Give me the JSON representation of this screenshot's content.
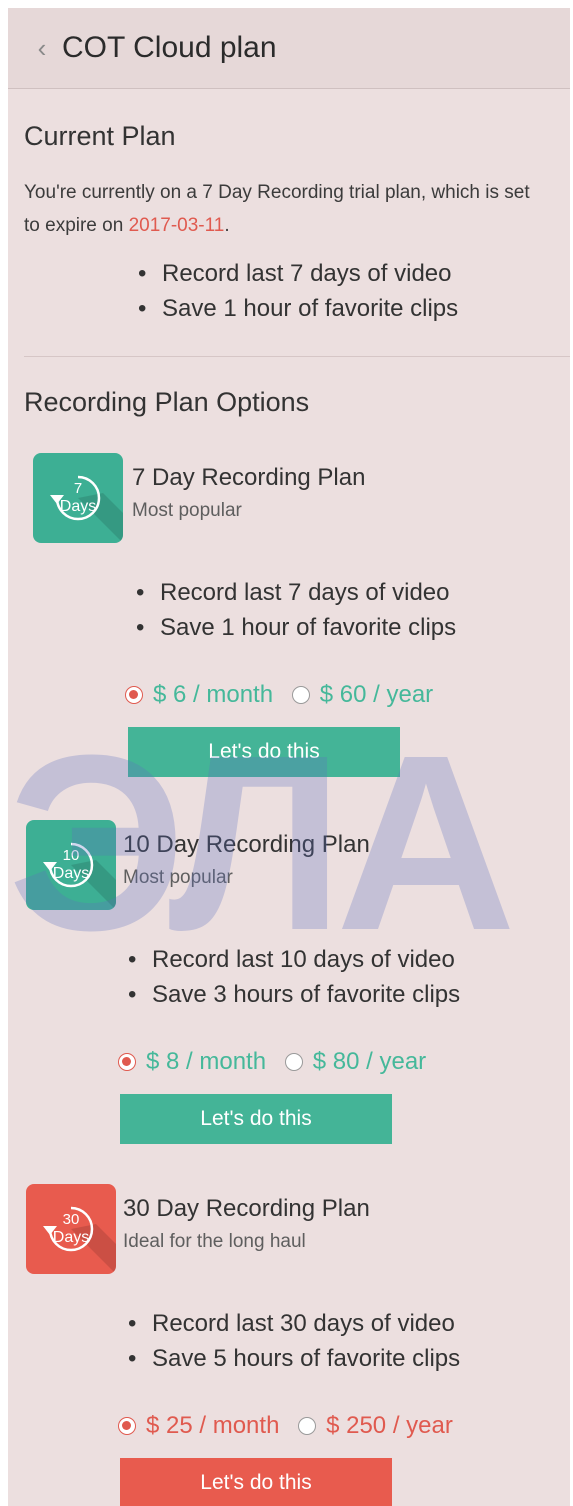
{
  "header": {
    "back_icon": "chevron-left-icon",
    "title": "COT Cloud plan"
  },
  "current_plan": {
    "heading": "Current Plan",
    "text_prefix": "You're currently on a 7 Day Recording trial plan, which is set to expire on ",
    "expiry_date": "2017-03-11",
    "text_suffix": ".",
    "features": [
      "Record last 7 days of video",
      "Save 1 hour of favorite clips"
    ]
  },
  "options_heading": "Recording Plan Options",
  "plans": [
    {
      "icon_number": "7",
      "icon_unit": "Days",
      "icon_color": "#3daf94",
      "name": "7 Day Recording Plan",
      "tagline": "Most popular",
      "features": [
        "Record last 7 days of video",
        "Save 1 hour of favorite clips"
      ],
      "monthly": "$ 6 / month",
      "yearly": "$ 60 / year",
      "selected": "monthly",
      "price_color": "#45b89a",
      "cta": "Let's do this",
      "cta_color": "#44b497"
    },
    {
      "icon_number": "10",
      "icon_unit": "Days",
      "icon_color": "#3daf94",
      "name": "10 Day Recording Plan",
      "tagline": "Most popular",
      "features": [
        "Record last 10 days of video",
        "Save 3 hours of favorite clips"
      ],
      "monthly": "$ 8 / month",
      "yearly": "$ 80 / year",
      "selected": "monthly",
      "price_color": "#45b89a",
      "cta": "Let's do this",
      "cta_color": "#44b497"
    },
    {
      "icon_number": "30",
      "icon_unit": "Days",
      "icon_color": "#e85b4e",
      "name": "30 Day Recording Plan",
      "tagline": "Ideal for the long haul",
      "features": [
        "Record last 30 days of video",
        "Save 5 hours of favorite clips"
      ],
      "monthly": "$ 25 / month",
      "yearly": "$ 250 / year",
      "selected": "monthly",
      "price_color": "#e05a4f",
      "cta": "Let's do this",
      "cta_color": "#e85b4e"
    }
  ],
  "watermark": "ЭЛА"
}
